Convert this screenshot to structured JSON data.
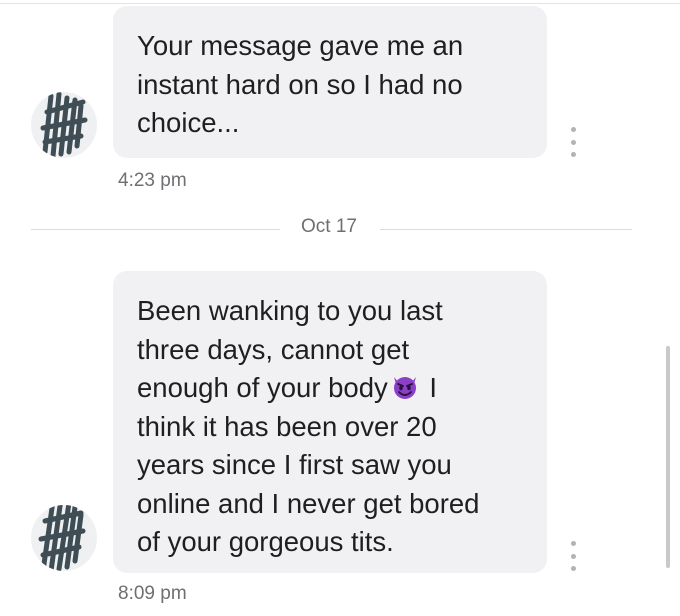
{
  "messages": [
    {
      "text": "Your message gave me an\ninstant hard on so I had no\nchoice...",
      "time": "4:23 pm"
    },
    {
      "text_before": "Been wanking to you last\nthree days, cannot get\nenough of your body",
      "emoji": "smiling-devil-emoji",
      "text_after": " I\nthink it has been over 20\nyears since I first saw you\nonline and I never get bored\nof your gorgeous tits.",
      "time": "8:09 pm"
    }
  ],
  "date_separator": "Oct 17",
  "colors": {
    "bubble": "#f1f1f3",
    "avatar_bg": "#eef0f1",
    "scribble": "#3f4d55",
    "emoji": "#8a3fc7"
  }
}
